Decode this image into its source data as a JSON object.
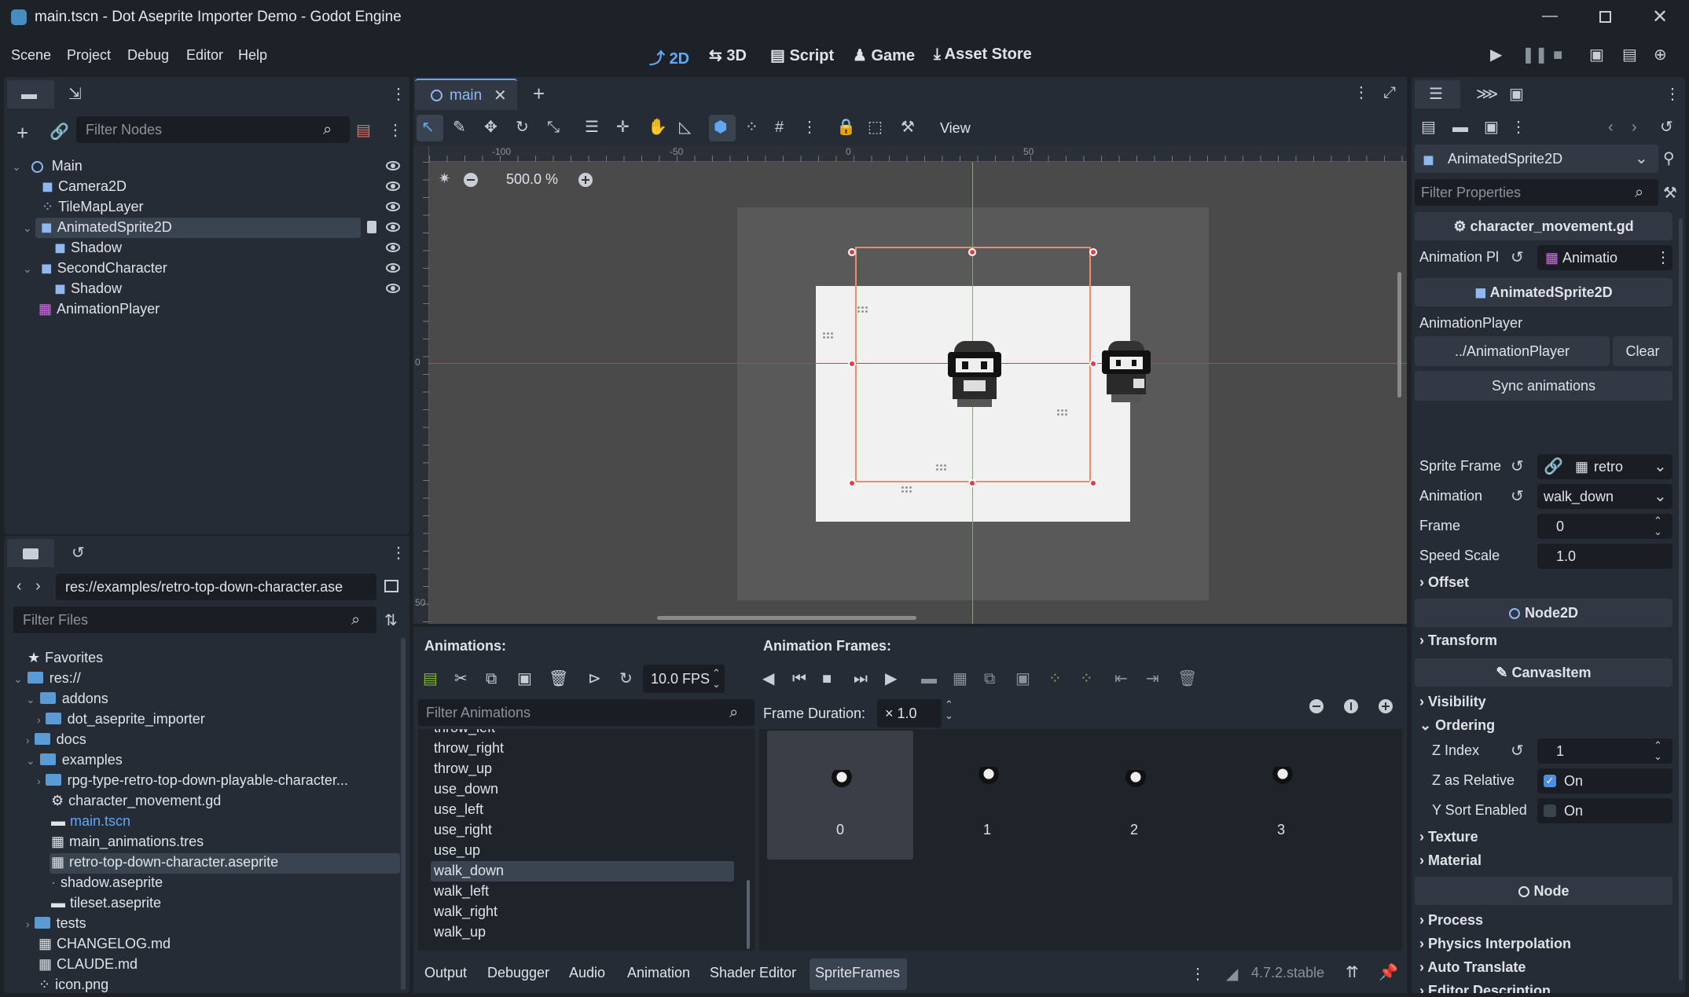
{
  "window": {
    "title": "main.tscn - Dot Aseprite Importer Demo - Godot Engine"
  },
  "menu": [
    "Scene",
    "Project",
    "Debug",
    "Editor",
    "Help"
  ],
  "workspaces": [
    "2D",
    "3D",
    "Script",
    "Game",
    "Asset Store"
  ],
  "scene_panel": {
    "filter_placeholder": "Filter Nodes",
    "nodes": [
      {
        "label": "Main"
      },
      {
        "label": "Camera2D"
      },
      {
        "label": "TileMapLayer"
      },
      {
        "label": "AnimatedSprite2D"
      },
      {
        "label": "Shadow"
      },
      {
        "label": "SecondCharacter"
      },
      {
        "label": "Shadow"
      },
      {
        "label": "AnimationPlayer"
      }
    ]
  },
  "filesystem": {
    "path": "res://examples/retro-top-down-character.ase",
    "filter_placeholder": "Filter Files",
    "items": [
      {
        "label": "Favorites"
      },
      {
        "label": "res://"
      },
      {
        "label": "addons"
      },
      {
        "label": "dot_aseprite_importer"
      },
      {
        "label": "docs"
      },
      {
        "label": "examples"
      },
      {
        "label": "rpg-type-retro-top-down-playable-character..."
      },
      {
        "label": "character_movement.gd"
      },
      {
        "label": "main.tscn"
      },
      {
        "label": "main_animations.tres"
      },
      {
        "label": "retro-top-down-character.aseprite"
      },
      {
        "label": "shadow.aseprite"
      },
      {
        "label": "tileset.aseprite"
      },
      {
        "label": "tests"
      },
      {
        "label": "CHANGELOG.md"
      },
      {
        "label": "CLAUDE.md"
      },
      {
        "label": "icon.png"
      }
    ]
  },
  "editor": {
    "tab": "main",
    "view_menu": "View",
    "zoom": "500.0 %",
    "ruler": [
      "-100",
      "-50",
      "0",
      "50"
    ],
    "ruler_v": [
      "0",
      "50"
    ]
  },
  "spriteframes": {
    "animations_label": "Animations:",
    "frames_label": "Animation Frames:",
    "fps": "10.0 FPS",
    "filter_placeholder": "Filter Animations",
    "frame_duration_label": "Frame Duration:",
    "frame_duration": "× 1.0",
    "animations": [
      "throw_left",
      "throw_right",
      "throw_up",
      "use_down",
      "use_left",
      "use_right",
      "use_up",
      "walk_down",
      "walk_left",
      "walk_right",
      "walk_up"
    ],
    "selected": "walk_down",
    "frames": [
      "0",
      "1",
      "2",
      "3"
    ]
  },
  "bottom_tabs": [
    "Output",
    "Debugger",
    "Audio",
    "Animation",
    "Shader Editor",
    "SpriteFrames"
  ],
  "version": "4.7.2.stable",
  "inspector": {
    "node_type": "AnimatedSprite2D",
    "filter_placeholder": "Filter Properties",
    "script": "character_movement.gd",
    "animation_player_label": "Animation Pl",
    "animation_player_value": "Animatio",
    "section_animated": "AnimatedSprite2D",
    "ap_title": "AnimationPlayer",
    "ap_path": "../AnimationPlayer",
    "clear": "Clear",
    "sync": "Sync animations",
    "sprite_frame_label": "Sprite Frame",
    "sprite_frame_value": "retro",
    "animation_label": "Animation",
    "animation_value": "walk_down",
    "frame_label": "Frame",
    "frame_value": "0",
    "speed_label": "Speed Scale",
    "speed_value": "1.0",
    "offset": "Offset",
    "node2d": "Node2D",
    "transform": "Transform",
    "canvasitem": "CanvasItem",
    "visibility": "Visibility",
    "ordering": "Ordering",
    "zindex_label": "Z Index",
    "zindex_value": "1",
    "zrel_label": "Z as Relative",
    "zrel_value": "On",
    "ysort_label": "Y Sort Enabled",
    "ysort_value": "On",
    "texture": "Texture",
    "material": "Material",
    "node": "Node",
    "process": "Process",
    "physics": "Physics Interpolation",
    "auto_translate": "Auto Translate",
    "editor_desc": "Editor Description"
  },
  "colors": {
    "accent": "#5fa8f5",
    "selection": "#3a4350",
    "guide_red": "#d23b4a",
    "guide_green": "#7fb33b",
    "handle": "#f08a6a"
  }
}
